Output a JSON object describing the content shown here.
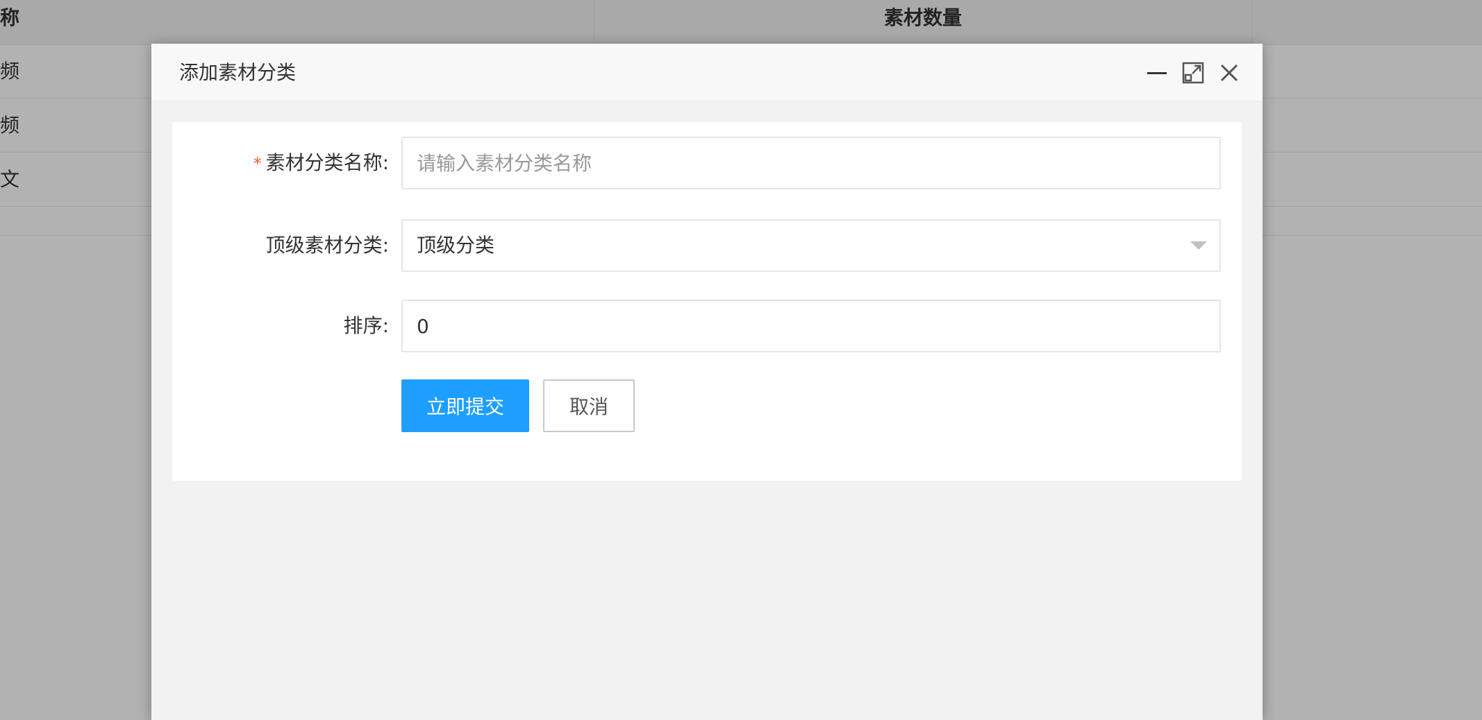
{
  "background_table": {
    "columns": [
      "名称",
      "素材数量"
    ],
    "rows": [
      "视频",
      "音频",
      "图文"
    ]
  },
  "dialog": {
    "title": "添加素材分类",
    "controls": {
      "minimize": "minimize-icon",
      "maximize": "maximize-icon",
      "close": "close-icon"
    },
    "form": {
      "name": {
        "required_mark": "*",
        "label": "素材分类名称:",
        "value": "",
        "placeholder": "请输入素材分类名称"
      },
      "parent": {
        "label": "顶级素材分类:",
        "selected": "顶级分类"
      },
      "sort": {
        "label": "排序:",
        "value": "0"
      },
      "submit_label": "立即提交",
      "cancel_label": "取消"
    }
  },
  "colors": {
    "primary": "#1e9fff",
    "required": "#ff5722",
    "overlay": "rgba(0,0,0,0.3)"
  }
}
